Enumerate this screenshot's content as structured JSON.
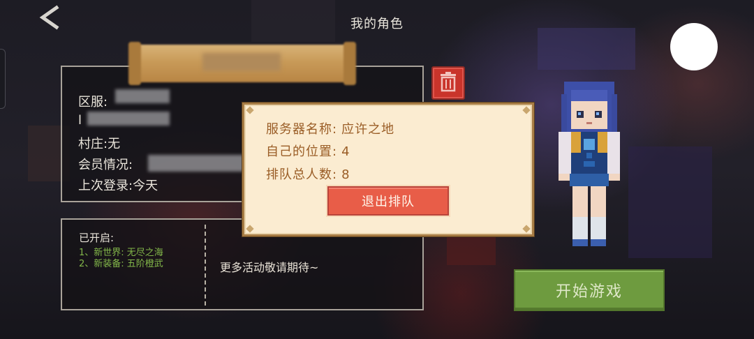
{
  "header": {
    "title": "我的角色",
    "back_icon": "chevron-left-icon"
  },
  "info_panel": {
    "server_label": "区服:",
    "server_sub": "l",
    "village_label": "村庄:",
    "village_value": "无",
    "membership_label": "会员情况:",
    "last_login_label": "上次登录:",
    "last_login_value": "今天"
  },
  "delete_button": {
    "icon": "trash-icon"
  },
  "events": {
    "title": "已开启:",
    "items": [
      "1、新世界: 无尽之海",
      "2、新装备: 五阶橙武"
    ],
    "more_text": "更多活动敬请期待~"
  },
  "queue_dialog": {
    "server_name_label": "服务器名称:",
    "server_name_value": "应许之地",
    "position_label": "自己的位置:",
    "position_value": "4",
    "total_label": "排队总人数:",
    "total_value": "8",
    "exit_button": "退出排队"
  },
  "start_button": {
    "label": "开始游戏"
  },
  "colors": {
    "dialog_bg": "#fbecd1",
    "dialog_text": "#9a5d26",
    "exit_button": "#e85d48",
    "start_button": "#6e9b3f",
    "delete_button": "#c9342b",
    "event_text": "#83b84a"
  }
}
